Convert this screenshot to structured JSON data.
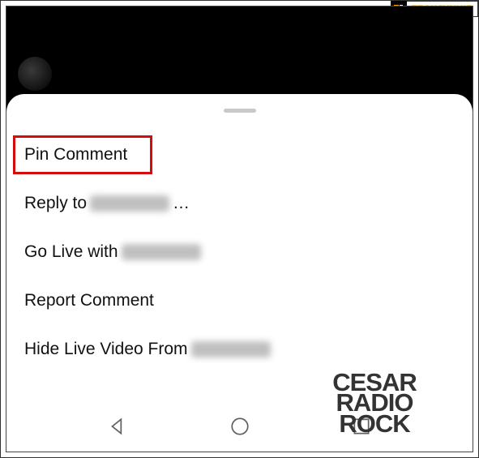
{
  "watermark": {
    "brand_text": "TECHJUNKIE"
  },
  "sheet": {
    "items": [
      {
        "label": "Pin Comment",
        "highlighted": true,
        "redacted_suffix": false,
        "ellipsis": false
      },
      {
        "label": "Reply to ",
        "highlighted": false,
        "redacted_suffix": true,
        "ellipsis": true
      },
      {
        "label": "Go Live with ",
        "highlighted": false,
        "redacted_suffix": true,
        "ellipsis": false
      },
      {
        "label": "Report Comment",
        "highlighted": false,
        "redacted_suffix": false,
        "ellipsis": false
      },
      {
        "label": "Hide Live Video From ",
        "highlighted": false,
        "redacted_suffix": true,
        "ellipsis": false
      }
    ]
  },
  "logo": {
    "line1": "CESAR",
    "line2": "RADIO",
    "line3": "ROCK"
  }
}
